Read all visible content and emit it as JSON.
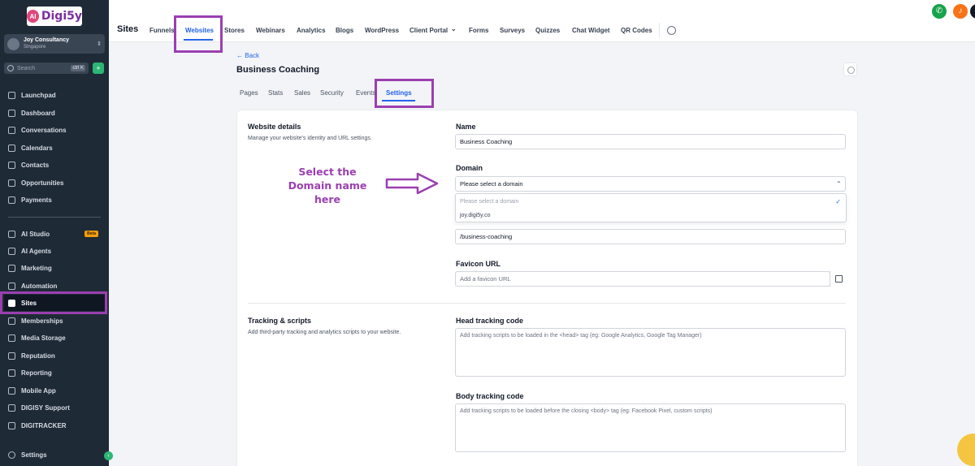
{
  "brand": {
    "logo_badge": "AI",
    "logo_text": "Digi5y"
  },
  "account": {
    "name": "Joy Consultancy",
    "location": "Singapore"
  },
  "search": {
    "placeholder": "Search",
    "shortcut": "ctrl K",
    "quick_action": "+"
  },
  "sidebar": {
    "items": [
      {
        "label": "Launchpad",
        "icon": "rocket-icon"
      },
      {
        "label": "Dashboard",
        "icon": "grid-icon"
      },
      {
        "label": "Conversations",
        "icon": "chat-icon"
      },
      {
        "label": "Calendars",
        "icon": "calendar-icon"
      },
      {
        "label": "Contacts",
        "icon": "contacts-icon"
      },
      {
        "label": "Opportunities",
        "icon": "funnel-icon"
      },
      {
        "label": "Payments",
        "icon": "payments-icon"
      },
      {
        "label": "AI Studio",
        "icon": "ai-studio-icon",
        "badge": "Beta"
      },
      {
        "label": "AI Agents",
        "icon": "sparkle-icon"
      },
      {
        "label": "Marketing",
        "icon": "send-icon"
      },
      {
        "label": "Automation",
        "icon": "automation-icon"
      },
      {
        "label": "Sites",
        "icon": "sites-icon",
        "active": true
      },
      {
        "label": "Memberships",
        "icon": "memberships-icon"
      },
      {
        "label": "Media Storage",
        "icon": "media-icon"
      },
      {
        "label": "Reputation",
        "icon": "star-icon"
      },
      {
        "label": "Reporting",
        "icon": "chart-icon"
      },
      {
        "label": "Mobile App",
        "icon": "mobile-icon"
      },
      {
        "label": "DIGISY Support",
        "icon": "support-icon"
      },
      {
        "label": "DIGITRACKER",
        "icon": "tracker-icon"
      }
    ],
    "settings_label": "Settings"
  },
  "topbar": {
    "title": "Sites",
    "tabs": [
      "Funnels",
      "Websites",
      "Stores",
      "Webinars",
      "Analytics",
      "Blogs",
      "WordPress",
      "Client Portal",
      "Forms",
      "Surveys",
      "Quizzes",
      "Chat Widget",
      "QR Codes"
    ],
    "active_tab": "Websites"
  },
  "page": {
    "back_label": "Back",
    "title": "Business Coaching",
    "subtabs": [
      "Pages",
      "Stats",
      "Sales",
      "Security",
      "Events",
      "Settings"
    ],
    "active_subtab": "Settings"
  },
  "website_details": {
    "title": "Website details",
    "description": "Manage your website's identity and URL settings.",
    "name_label": "Name",
    "name_value": "Business Coaching",
    "domain_label": "Domain",
    "domain_placeholder": "Please select a domain",
    "domain_options": [
      "Please select a domain",
      "joy.digi5y.co"
    ],
    "path_value": "/business-coaching",
    "favicon_label": "Favicon URL",
    "favicon_placeholder": "Add a favicon URL"
  },
  "tracking": {
    "title": "Tracking & scripts",
    "description": "Add third-party tracking and analytics scripts to your website.",
    "head_label": "Head tracking code",
    "head_placeholder": "Add tracking scripts to be loaded in the <head> tag (eg: Google Analytics, Google Tag Manager)",
    "body_label": "Body tracking code",
    "body_placeholder": "Add tracking scripts to be loaded before the closing <body> tag (eg: Facebook Pixel, custom scripts)"
  },
  "annotation": {
    "line1": "Select the",
    "line2": "Domain name",
    "line3": "here"
  },
  "colors": {
    "accent": "#2563eb",
    "highlight": "#9b3fb0",
    "sidebar_bg": "#1f2a37",
    "success": "#16a34a"
  }
}
